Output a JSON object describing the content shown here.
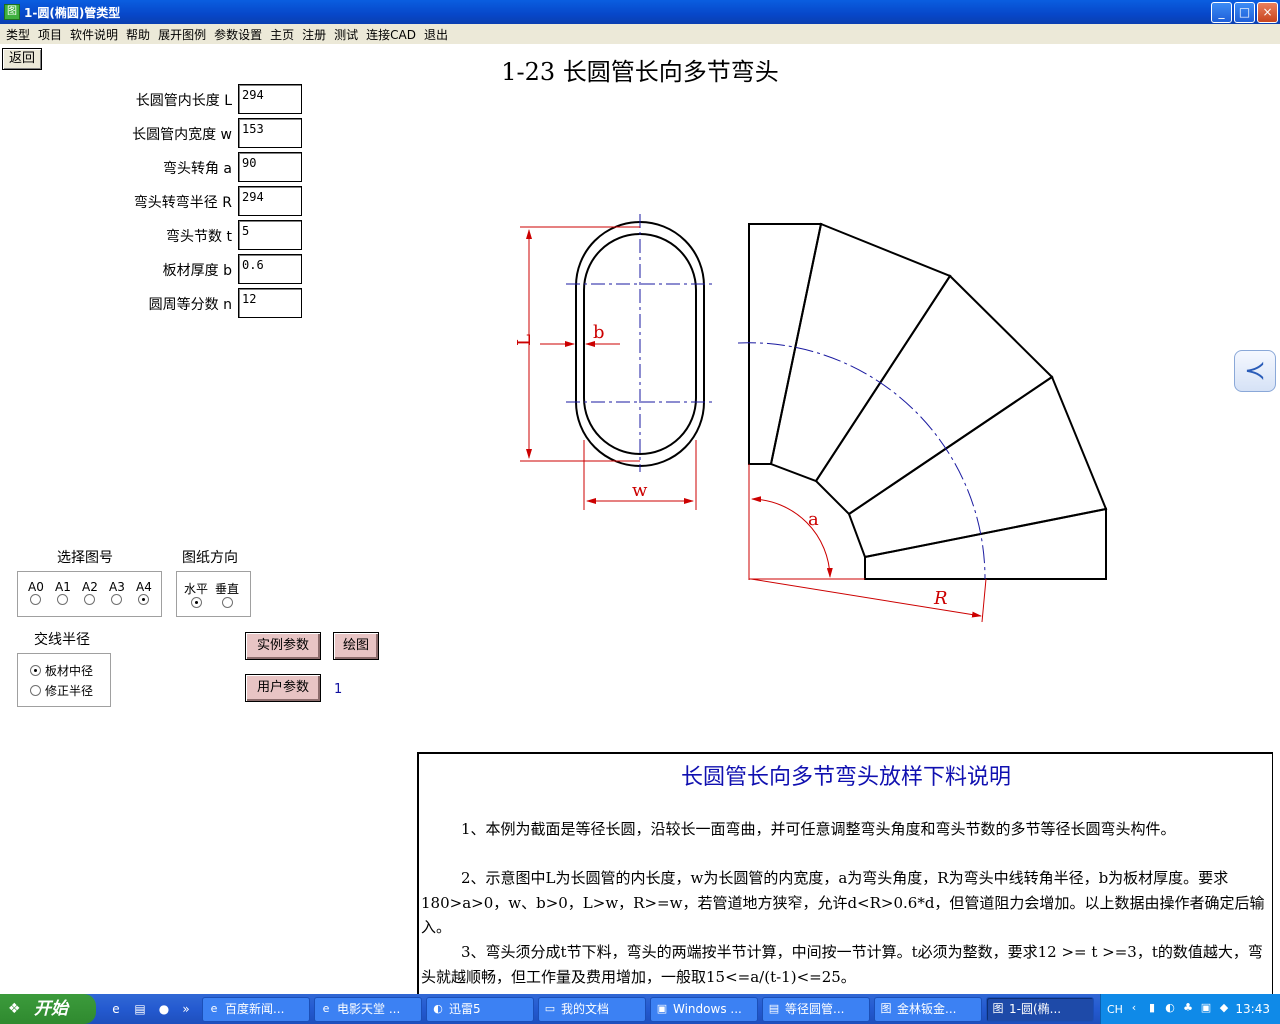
{
  "window": {
    "title": "1-圆(椭圆)管类型",
    "min": "_",
    "max": "□",
    "close": "×"
  },
  "menu": [
    "类型",
    "项目",
    "软件说明",
    "帮助",
    "展开图例",
    "参数设置",
    "主页",
    "注册",
    "测试",
    "连接CAD",
    "退出"
  ],
  "back_label": "返回",
  "page_title": "1-23 长圆管长向多节弯头",
  "params": [
    {
      "label": "长圆管内长度 L",
      "value": "294"
    },
    {
      "label": "长圆管内宽度 w",
      "value": "153"
    },
    {
      "label": "弯头转角 a",
      "value": "90"
    },
    {
      "label": "弯头转弯半径 R",
      "value": "294"
    },
    {
      "label": "弯头节数 t",
      "value": "5"
    },
    {
      "label": "板材厚度 b",
      "value": "0.6"
    },
    {
      "label": "圆周等分数 n",
      "value": "12"
    }
  ],
  "paper_size": {
    "title": "选择图号",
    "options": [
      "A0",
      "A1",
      "A2",
      "A3",
      "A4"
    ],
    "selected": "A4"
  },
  "orientation": {
    "title": "图纸方向",
    "options": [
      "水平",
      "垂直"
    ],
    "selected": "水平"
  },
  "radius": {
    "title": "交线半径",
    "options": [
      "板材中径",
      "修正半径"
    ],
    "selected": "板材中径"
  },
  "buttons": {
    "example": "实例参数",
    "draw": "绘图",
    "user": "用户参数"
  },
  "user_value": "1",
  "diagram_labels": {
    "L": "L",
    "b": "b",
    "w": "w",
    "a": "a",
    "R": "R"
  },
  "description": {
    "title": "长圆管长向多节弯头放样下料说明",
    "paragraphs": [
      "1、本例为截面是等径长圆，沿较长一面弯曲，并可任意调整弯头角度和弯头节数的多节等径长圆弯头构件。",
      "2、示意图中L为长圆管的内长度，w为长圆管的内宽度，a为弯头角度，R为弯头中线转角半径，b为板材厚度。要求180>a>0，w、b>0，L>w，R>=w，若管道地方狭窄，允许d<R>0.6*d，但管道阻力会增加。以上数据由操作者确定后输入。",
      "3、弯头须分成t节下料，弯头的两端按半节计算，中间按一节计算。t必须为整数，要求12 >= t >=3，t的数值越大，弯头就越顺畅，但工作量及费用增加，一般取15<=a/(t-1)<=25。"
    ]
  },
  "taskbar": {
    "start": "开始",
    "tasks": [
      "百度新闻...",
      "电影天堂 ...",
      "迅雷5",
      "我的文档",
      "Windows ...",
      "等径圆管...",
      "金林钣金...",
      "1-圆(椭..."
    ],
    "active": 7,
    "lang": "CH",
    "clock": "13:43"
  },
  "colors": {
    "accent_blue": "#1010b0",
    "diagram_red": "#cc0000",
    "diagram_blue": "#1a1aa0",
    "pink_button": "#e8c4c4"
  }
}
